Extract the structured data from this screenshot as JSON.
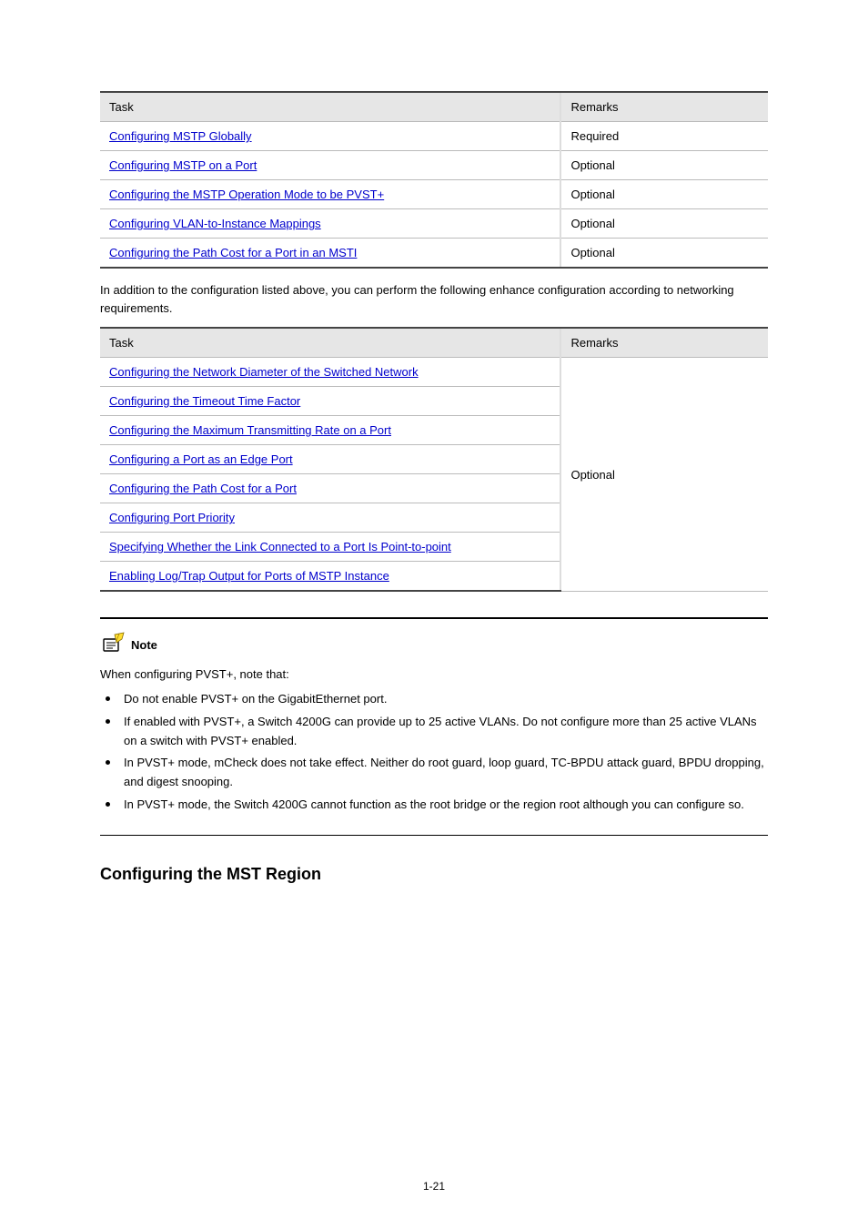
{
  "table1": {
    "header_task": "Task",
    "header_remarks": "Remarks",
    "rows": [
      {
        "link": "Configuring MSTP Globally",
        "remarks": "Required"
      },
      {
        "link": "Configuring MSTP on a Port",
        "remarks": "Optional"
      },
      {
        "link": "Configuring the MSTP Operation Mode to be PVST+",
        "remarks": "Optional"
      },
      {
        "link": "Configuring VLAN-to-Instance Mappings",
        "remarks": "Optional"
      },
      {
        "link": "Configuring the Path Cost for a Port in an MSTI",
        "remarks": "Optional"
      }
    ]
  },
  "para1": "In addition to the configuration listed above, you can perform the following enhance configuration according to networking requirements.",
  "table2": {
    "header_task": "Task",
    "header_remarks": "Remarks",
    "rows": [
      {
        "link": "Configuring the Network Diameter of the Switched Network"
      },
      {
        "link": "Configuring the Timeout Time Factor"
      },
      {
        "link": "Configuring the Maximum Transmitting Rate on a Port"
      },
      {
        "link": "Configuring a Port as an Edge Port"
      },
      {
        "link": "Configuring the Path Cost for a Port"
      },
      {
        "link": "Configuring Port Priority"
      },
      {
        "link": "Specifying Whether the Link Connected to a Port Is Point-to-point"
      },
      {
        "link": "Enabling Log/Trap Output for Ports of MSTP Instance"
      }
    ]
  },
  "note_icon": "note-icon",
  "note_label": "Note",
  "note_intro": "When configuring PVST+, note that:",
  "note_items": [
    "Do not enable PVST+ on the GigabitEthernet port.",
    "If enabled with PVST+, a Switch 4200G can provide up to 25 active VLANs. Do not configure more than 25 active VLANs on a switch with PVST+ enabled.",
    "In PVST+ mode, mCheck does not take effect. Neither do root guard, loop guard, TC-BPDU attack guard, BPDU dropping, and digest snooping.",
    "In PVST+ mode, the Switch 4200G cannot function as the root bridge or the region root although you can configure so."
  ],
  "section_title": "Configuring the MST Region",
  "page_number": "1-21"
}
